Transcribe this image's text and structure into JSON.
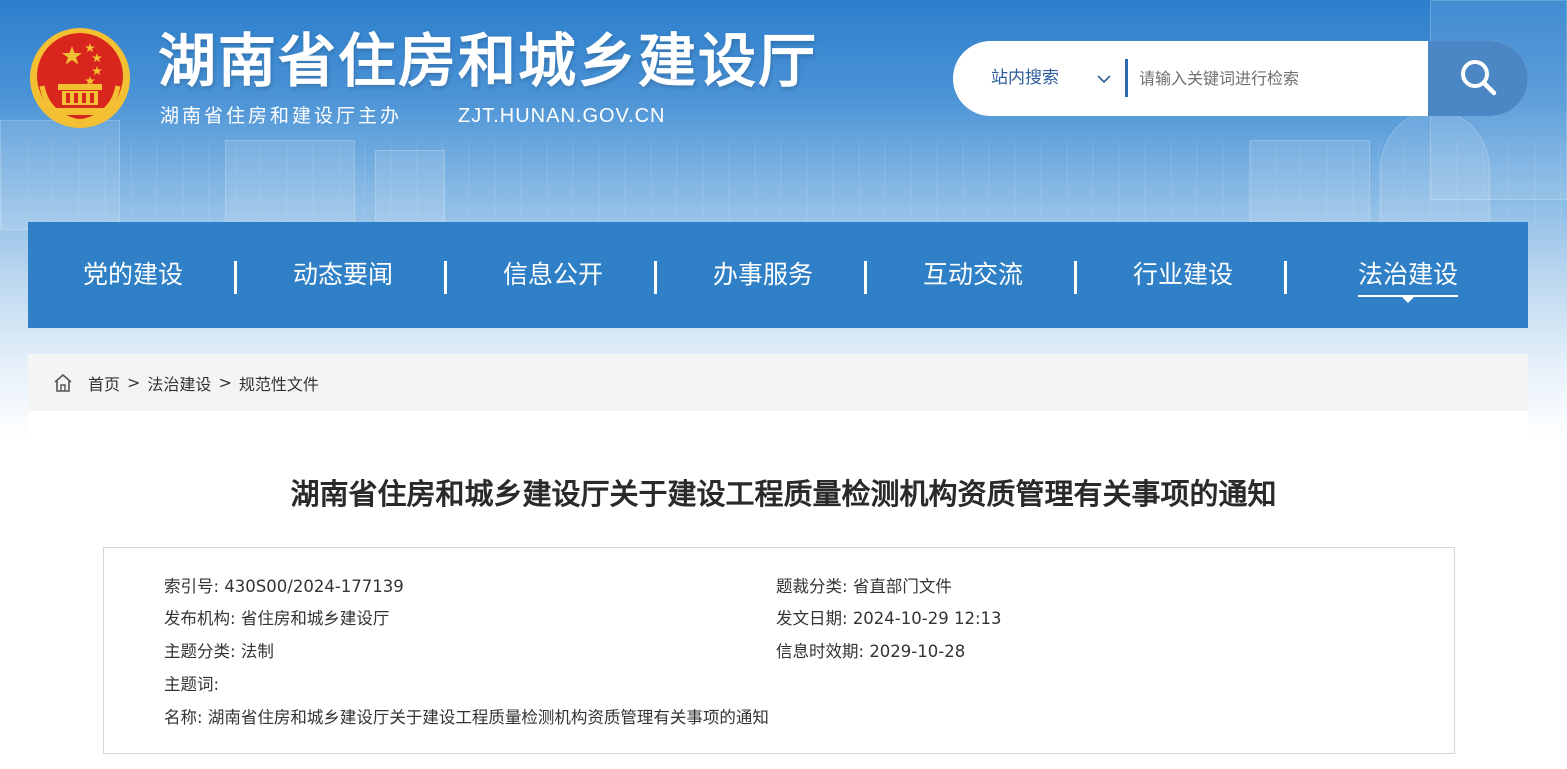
{
  "header": {
    "site_title": "湖南省住房和城乡建设厅",
    "sponsor": "湖南省住房和建设厅主办",
    "domain": "ZJT.HUNAN.GOV.CN",
    "emblem_icon": "national-emblem-icon"
  },
  "search": {
    "scope_selected": "站内搜索",
    "placeholder": "请输入关键词进行检索",
    "value": "",
    "button_icon": "search-icon"
  },
  "nav": {
    "items": [
      {
        "label": "党的建设"
      },
      {
        "label": "动态要闻"
      },
      {
        "label": "信息公开"
      },
      {
        "label": "办事服务"
      },
      {
        "label": "互动交流"
      },
      {
        "label": "行业建设"
      },
      {
        "label": "法治建设",
        "active": true
      }
    ]
  },
  "breadcrumb": {
    "home_icon": "home-icon",
    "items": [
      "首页",
      "法治建设",
      "规范性文件"
    ],
    "separator": ">"
  },
  "article": {
    "title": "湖南省住房和城乡建设厅关于建设工程质量检测机构资质管理有关事项的通知",
    "meta": {
      "index_label": "索引号:",
      "index_value": "430S00/2024-177139",
      "genre_label": "题裁分类:",
      "genre_value": "省直部门文件",
      "publisher_label": "发布机构:",
      "publisher_value": "省住房和城乡建设厅",
      "date_label": "发文日期:",
      "date_value": "2024-10-29 12:13",
      "topic_label": "主题分类:",
      "topic_value": "法制",
      "validity_label": "信息时效期:",
      "validity_value": "2029-10-28",
      "keywords_label": "主题词:",
      "keywords_value": "",
      "name_label": "名称:",
      "name_value": "湖南省住房和城乡建设厅关于建设工程质量检测机构资质管理有关事项的通知"
    }
  },
  "colors": {
    "nav_bg": "#2f80c7",
    "search_button": "#4b87c5",
    "breadcrumb_bg": "#f4f4f4",
    "emblem_red": "#d8261e",
    "emblem_gold": "#f3c033"
  }
}
